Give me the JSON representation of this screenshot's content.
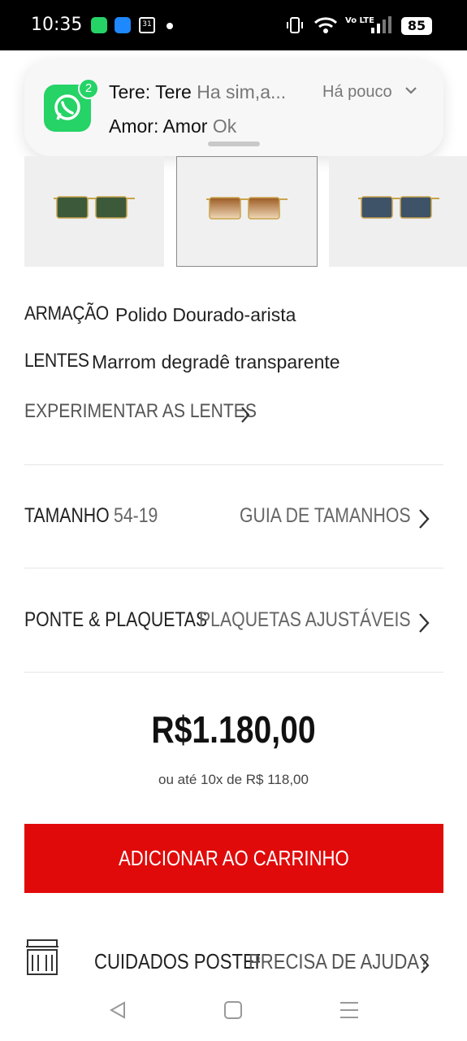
{
  "status_bar": {
    "time": "10:35",
    "calendar_day": "31",
    "network": "Vo LTE",
    "battery": "85"
  },
  "notification": {
    "app_icon": "whatsapp-icon",
    "badge_count": "2",
    "line1_sender": "Tere: Tere",
    "line1_message": "Ha sim,a...",
    "time": "Há pouco",
    "line2_sender": "Amor: Amor",
    "line2_message": "Ok"
  },
  "thumbnails": [
    {
      "lens_color": "#3c5a3a",
      "frame": "gold"
    },
    {
      "lens_color": "#b87a4a",
      "frame": "gold"
    },
    {
      "lens_color": "#3e5268",
      "frame": "gold"
    }
  ],
  "specs": {
    "frame_label": "ARMAÇÃO",
    "frame_value": "Polido Dourado-arista",
    "lens_label": "LENTES",
    "lens_value": "Marrom degradê transparente",
    "try_lenses": "EXPERIMENTAR AS LENTES"
  },
  "size_row": {
    "label": "TAMANHO",
    "value": "54-19",
    "link": "GUIA DE TAMANHOS"
  },
  "bridge_row": {
    "label": "PONTE & PLAQUETAS",
    "value": "PLAQUETAS AJUSTÁVEIS"
  },
  "price": {
    "amount": "R$1.180,00",
    "installments": "ou até 10x de R$ 118,00"
  },
  "cta": {
    "add_to_cart": "ADICIONAR AO CARRINHO"
  },
  "footer": {
    "care_label": "CUIDADOS POSTERI",
    "help_label": "PRECISA DE AJUDA?"
  },
  "colors": {
    "accent_red": "#e10a0a",
    "whatsapp_green": "#25d366"
  }
}
